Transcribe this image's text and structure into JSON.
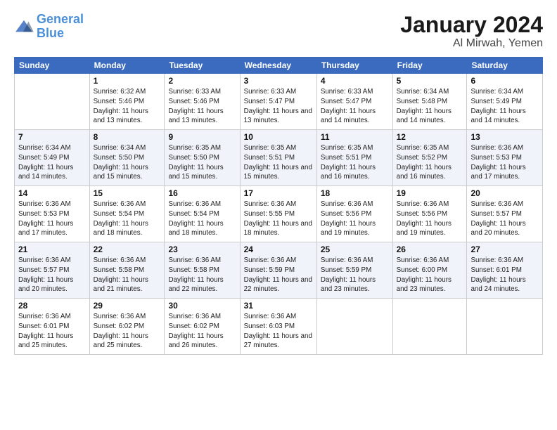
{
  "logo": {
    "line1": "General",
    "line2": "Blue"
  },
  "title": "January 2024",
  "location": "Al Mirwah, Yemen",
  "days_of_week": [
    "Sunday",
    "Monday",
    "Tuesday",
    "Wednesday",
    "Thursday",
    "Friday",
    "Saturday"
  ],
  "weeks": [
    [
      {
        "num": "",
        "sunrise": "",
        "sunset": "",
        "daylight": ""
      },
      {
        "num": "1",
        "sunrise": "Sunrise: 6:32 AM",
        "sunset": "Sunset: 5:46 PM",
        "daylight": "Daylight: 11 hours and 13 minutes."
      },
      {
        "num": "2",
        "sunrise": "Sunrise: 6:33 AM",
        "sunset": "Sunset: 5:46 PM",
        "daylight": "Daylight: 11 hours and 13 minutes."
      },
      {
        "num": "3",
        "sunrise": "Sunrise: 6:33 AM",
        "sunset": "Sunset: 5:47 PM",
        "daylight": "Daylight: 11 hours and 13 minutes."
      },
      {
        "num": "4",
        "sunrise": "Sunrise: 6:33 AM",
        "sunset": "Sunset: 5:47 PM",
        "daylight": "Daylight: 11 hours and 14 minutes."
      },
      {
        "num": "5",
        "sunrise": "Sunrise: 6:34 AM",
        "sunset": "Sunset: 5:48 PM",
        "daylight": "Daylight: 11 hours and 14 minutes."
      },
      {
        "num": "6",
        "sunrise": "Sunrise: 6:34 AM",
        "sunset": "Sunset: 5:49 PM",
        "daylight": "Daylight: 11 hours and 14 minutes."
      }
    ],
    [
      {
        "num": "7",
        "sunrise": "Sunrise: 6:34 AM",
        "sunset": "Sunset: 5:49 PM",
        "daylight": "Daylight: 11 hours and 14 minutes."
      },
      {
        "num": "8",
        "sunrise": "Sunrise: 6:34 AM",
        "sunset": "Sunset: 5:50 PM",
        "daylight": "Daylight: 11 hours and 15 minutes."
      },
      {
        "num": "9",
        "sunrise": "Sunrise: 6:35 AM",
        "sunset": "Sunset: 5:50 PM",
        "daylight": "Daylight: 11 hours and 15 minutes."
      },
      {
        "num": "10",
        "sunrise": "Sunrise: 6:35 AM",
        "sunset": "Sunset: 5:51 PM",
        "daylight": "Daylight: 11 hours and 15 minutes."
      },
      {
        "num": "11",
        "sunrise": "Sunrise: 6:35 AM",
        "sunset": "Sunset: 5:51 PM",
        "daylight": "Daylight: 11 hours and 16 minutes."
      },
      {
        "num": "12",
        "sunrise": "Sunrise: 6:35 AM",
        "sunset": "Sunset: 5:52 PM",
        "daylight": "Daylight: 11 hours and 16 minutes."
      },
      {
        "num": "13",
        "sunrise": "Sunrise: 6:36 AM",
        "sunset": "Sunset: 5:53 PM",
        "daylight": "Daylight: 11 hours and 17 minutes."
      }
    ],
    [
      {
        "num": "14",
        "sunrise": "Sunrise: 6:36 AM",
        "sunset": "Sunset: 5:53 PM",
        "daylight": "Daylight: 11 hours and 17 minutes."
      },
      {
        "num": "15",
        "sunrise": "Sunrise: 6:36 AM",
        "sunset": "Sunset: 5:54 PM",
        "daylight": "Daylight: 11 hours and 18 minutes."
      },
      {
        "num": "16",
        "sunrise": "Sunrise: 6:36 AM",
        "sunset": "Sunset: 5:54 PM",
        "daylight": "Daylight: 11 hours and 18 minutes."
      },
      {
        "num": "17",
        "sunrise": "Sunrise: 6:36 AM",
        "sunset": "Sunset: 5:55 PM",
        "daylight": "Daylight: 11 hours and 18 minutes."
      },
      {
        "num": "18",
        "sunrise": "Sunrise: 6:36 AM",
        "sunset": "Sunset: 5:56 PM",
        "daylight": "Daylight: 11 hours and 19 minutes."
      },
      {
        "num": "19",
        "sunrise": "Sunrise: 6:36 AM",
        "sunset": "Sunset: 5:56 PM",
        "daylight": "Daylight: 11 hours and 19 minutes."
      },
      {
        "num": "20",
        "sunrise": "Sunrise: 6:36 AM",
        "sunset": "Sunset: 5:57 PM",
        "daylight": "Daylight: 11 hours and 20 minutes."
      }
    ],
    [
      {
        "num": "21",
        "sunrise": "Sunrise: 6:36 AM",
        "sunset": "Sunset: 5:57 PM",
        "daylight": "Daylight: 11 hours and 20 minutes."
      },
      {
        "num": "22",
        "sunrise": "Sunrise: 6:36 AM",
        "sunset": "Sunset: 5:58 PM",
        "daylight": "Daylight: 11 hours and 21 minutes."
      },
      {
        "num": "23",
        "sunrise": "Sunrise: 6:36 AM",
        "sunset": "Sunset: 5:58 PM",
        "daylight": "Daylight: 11 hours and 22 minutes."
      },
      {
        "num": "24",
        "sunrise": "Sunrise: 6:36 AM",
        "sunset": "Sunset: 5:59 PM",
        "daylight": "Daylight: 11 hours and 22 minutes."
      },
      {
        "num": "25",
        "sunrise": "Sunrise: 6:36 AM",
        "sunset": "Sunset: 5:59 PM",
        "daylight": "Daylight: 11 hours and 23 minutes."
      },
      {
        "num": "26",
        "sunrise": "Sunrise: 6:36 AM",
        "sunset": "Sunset: 6:00 PM",
        "daylight": "Daylight: 11 hours and 23 minutes."
      },
      {
        "num": "27",
        "sunrise": "Sunrise: 6:36 AM",
        "sunset": "Sunset: 6:01 PM",
        "daylight": "Daylight: 11 hours and 24 minutes."
      }
    ],
    [
      {
        "num": "28",
        "sunrise": "Sunrise: 6:36 AM",
        "sunset": "Sunset: 6:01 PM",
        "daylight": "Daylight: 11 hours and 25 minutes."
      },
      {
        "num": "29",
        "sunrise": "Sunrise: 6:36 AM",
        "sunset": "Sunset: 6:02 PM",
        "daylight": "Daylight: 11 hours and 25 minutes."
      },
      {
        "num": "30",
        "sunrise": "Sunrise: 6:36 AM",
        "sunset": "Sunset: 6:02 PM",
        "daylight": "Daylight: 11 hours and 26 minutes."
      },
      {
        "num": "31",
        "sunrise": "Sunrise: 6:36 AM",
        "sunset": "Sunset: 6:03 PM",
        "daylight": "Daylight: 11 hours and 27 minutes."
      },
      {
        "num": "",
        "sunrise": "",
        "sunset": "",
        "daylight": ""
      },
      {
        "num": "",
        "sunrise": "",
        "sunset": "",
        "daylight": ""
      },
      {
        "num": "",
        "sunrise": "",
        "sunset": "",
        "daylight": ""
      }
    ]
  ]
}
